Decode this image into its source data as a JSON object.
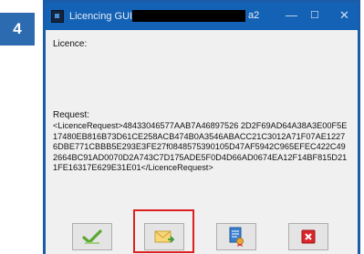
{
  "step": {
    "number": "4"
  },
  "window": {
    "title_prefix": "Licencing GUID: 7",
    "title_suffix": "a2",
    "minimize": "—",
    "maximize": "☐",
    "close": "✕"
  },
  "licence": {
    "label": "Licence:"
  },
  "request": {
    "label": "Request:",
    "text": "<LicenceRequest>48433046577AAB7A46897526 2D2F69AD64A38A3E00F5E17480EB816B73D61CE258ACB474B0A3546ABACC21C3012A71F07AE12276DBE771CBBB5E293E3FE27f0848575390105D47AF5942C965EFEC422C492664BC91AD0070D2A743C7D175ADE5F0D4D66AD0674EA12F14BF815D211FE16317E629E31E01</LicenceRequest>"
  },
  "buttons": [
    {
      "name": "accept",
      "icon": "checkmark-icon"
    },
    {
      "name": "email",
      "icon": "envelope-icon"
    },
    {
      "name": "certificate",
      "icon": "certificate-icon"
    },
    {
      "name": "cancel",
      "icon": "close-red-icon"
    }
  ],
  "colors": {
    "accent": "#1462b5",
    "badge": "#2d6bb0",
    "highlight": "#e02020"
  }
}
